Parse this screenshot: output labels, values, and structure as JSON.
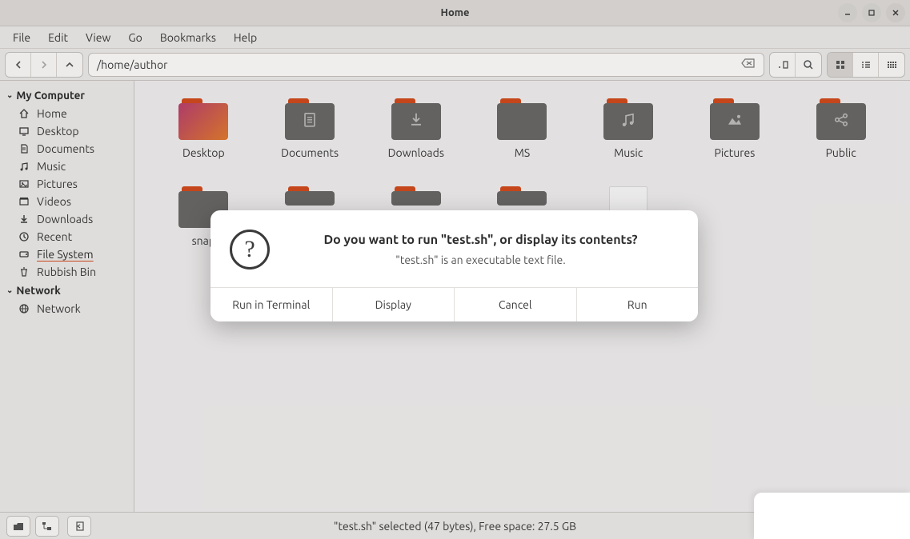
{
  "window": {
    "title": "Home"
  },
  "menubar": [
    "File",
    "Edit",
    "View",
    "Go",
    "Bookmarks",
    "Help"
  ],
  "path": "/home/author",
  "sidebar": {
    "sections": [
      {
        "heading": "My Computer",
        "items": [
          {
            "icon": "home",
            "label": "Home"
          },
          {
            "icon": "desktop",
            "label": "Desktop"
          },
          {
            "icon": "doc",
            "label": "Documents"
          },
          {
            "icon": "music",
            "label": "Music"
          },
          {
            "icon": "pic",
            "label": "Pictures"
          },
          {
            "icon": "vid",
            "label": "Videos"
          },
          {
            "icon": "down",
            "label": "Downloads"
          },
          {
            "icon": "recent",
            "label": "Recent"
          },
          {
            "icon": "fs",
            "label": "File System",
            "selected": true
          },
          {
            "icon": "trash",
            "label": "Rubbish Bin"
          }
        ]
      },
      {
        "heading": "Network",
        "items": [
          {
            "icon": "net",
            "label": "Network"
          }
        ]
      }
    ]
  },
  "files": {
    "row1": [
      {
        "name": "Desktop",
        "type": "folder-wall"
      },
      {
        "name": "Documents",
        "type": "folder",
        "emblem": "doc"
      },
      {
        "name": "Downloads",
        "type": "folder",
        "emblem": "down"
      },
      {
        "name": "MS",
        "type": "folder"
      },
      {
        "name": "Music",
        "type": "folder",
        "emblem": "music"
      },
      {
        "name": "Pictures",
        "type": "folder",
        "emblem": "pic"
      },
      {
        "name": "Public",
        "type": "folder",
        "emblem": "share"
      }
    ],
    "row2": [
      {
        "name": "snap",
        "type": "folder"
      },
      {
        "name": "",
        "type": "folder-clip"
      },
      {
        "name": "",
        "type": "folder-clip"
      },
      {
        "name": "",
        "type": "folder-clip"
      },
      {
        "name": "",
        "type": "textfile-clip"
      }
    ]
  },
  "statusbar": {
    "text": "\"test.sh\" selected (47 bytes), Free space: 27.5 GB"
  },
  "dialog": {
    "title": "Do you want to run \"test.sh\", or display its contents?",
    "subtitle": "\"test.sh\" is an executable text file.",
    "buttons": [
      "Run in Terminal",
      "Display",
      "Cancel",
      "Run"
    ]
  },
  "colors": {
    "folder_tab": "#d04a1c",
    "folder_body": "#6a6867",
    "wallpaper_a": "#b83f6e",
    "wallpaper_b": "#e07a2d"
  }
}
